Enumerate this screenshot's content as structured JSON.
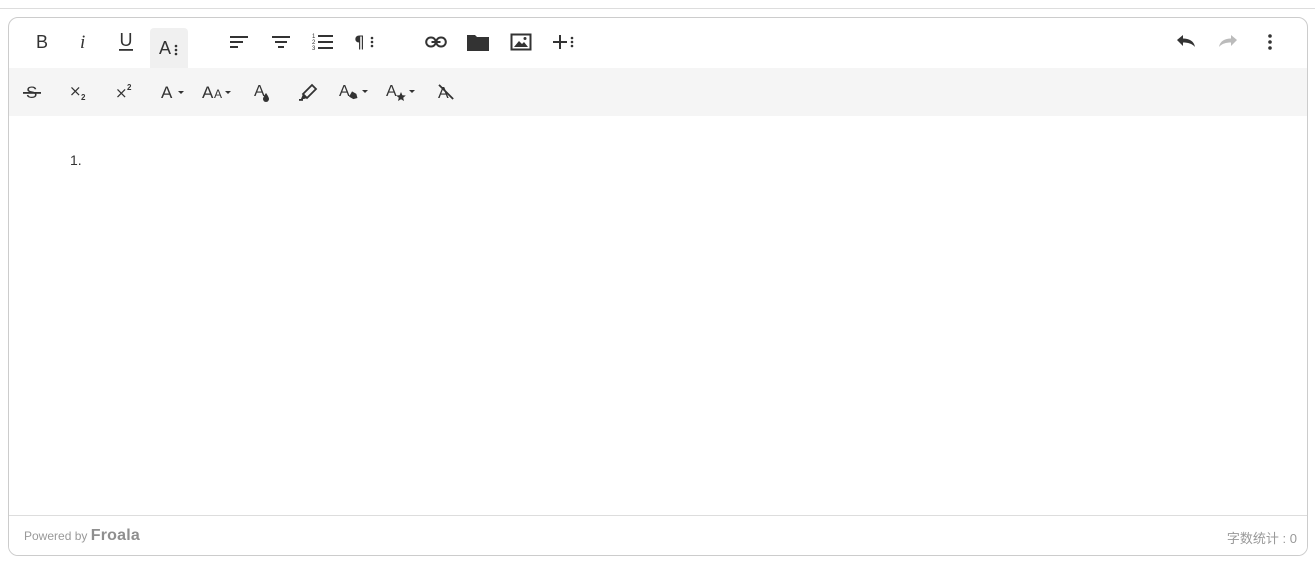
{
  "editor": {
    "content": {
      "list_marker": "1."
    },
    "footer": {
      "powered_prefix": "Powered by",
      "powered_brand": "Froala",
      "word_count": "字数统计 : 0"
    }
  },
  "toolbar": {
    "main": [
      {
        "name": "bold-button",
        "icon": "bold-icon"
      },
      {
        "name": "italic-button",
        "icon": "italic-icon"
      },
      {
        "name": "underline-button",
        "icon": "underline-icon"
      },
      {
        "name": "more-text-button",
        "icon": "more-text-icon",
        "active": true
      },
      {
        "name": "align-left-button",
        "icon": "align-left-icon"
      },
      {
        "name": "align-center-button",
        "icon": "align-center-icon"
      },
      {
        "name": "ordered-list-button",
        "icon": "ordered-list-icon"
      },
      {
        "name": "more-paragraph-button",
        "icon": "paragraph-icon"
      },
      {
        "name": "insert-link-button",
        "icon": "link-icon"
      },
      {
        "name": "insert-file-button",
        "icon": "folder-icon"
      },
      {
        "name": "insert-image-button",
        "icon": "image-icon"
      },
      {
        "name": "more-rich-button",
        "icon": "plus-icon"
      },
      {
        "name": "undo-button",
        "icon": "undo-icon"
      },
      {
        "name": "redo-button",
        "icon": "redo-icon",
        "disabled": true
      },
      {
        "name": "more-misc-button",
        "icon": "vertical-dots-icon"
      }
    ],
    "more_text": [
      {
        "name": "strikethrough-button",
        "icon": "strikethrough-icon"
      },
      {
        "name": "subscript-button",
        "icon": "subscript-icon"
      },
      {
        "name": "superscript-button",
        "icon": "superscript-icon"
      },
      {
        "name": "font-family-button",
        "icon": "font-family-icon"
      },
      {
        "name": "font-size-button",
        "icon": "font-size-icon"
      },
      {
        "name": "text-color-button",
        "icon": "text-color-icon"
      },
      {
        "name": "background-color-button",
        "icon": "highlighter-icon"
      },
      {
        "name": "inline-class-button",
        "icon": "inline-class-icon"
      },
      {
        "name": "inline-style-button",
        "icon": "inline-style-icon"
      },
      {
        "name": "clear-formatting-button",
        "icon": "clear-formatting-icon"
      }
    ]
  },
  "colors": {
    "icon": "#333333",
    "disabled_icon": "#bbbbbb",
    "toolbar_bg": "#f5f5f5",
    "border": "#cccccc"
  }
}
